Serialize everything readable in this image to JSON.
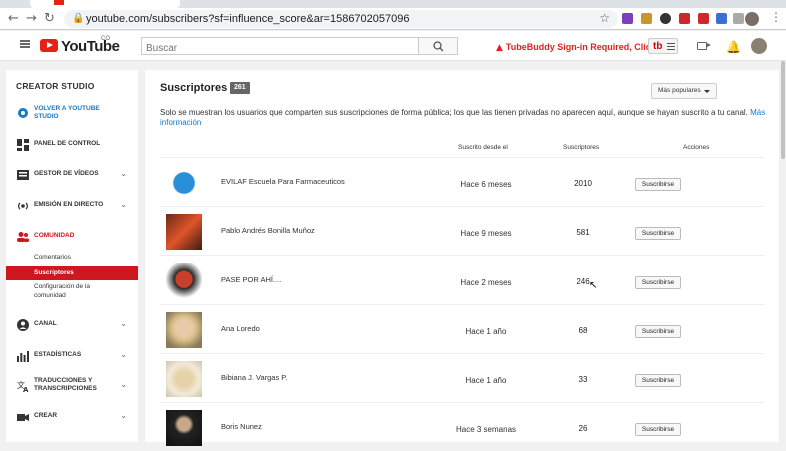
{
  "browser": {
    "url": "youtube.com/subscribers?sf=influence_score&ar=1586702057096"
  },
  "header": {
    "logo_text": "YouTube",
    "region": "CO",
    "search_placeholder": "Buscar",
    "tubebuddy_warning": "TubeBuddy Sign-in Required, Click Here",
    "tubebuddy_badge": "tb"
  },
  "sidebar": {
    "title": "CREATOR STUDIO",
    "items": {
      "back": "VOLVER A YOUTUBE STUDIO",
      "dashboard": "PANEL DE CONTROL",
      "videos": "GESTOR DE VÍDEOS",
      "live": "EMISIÓN EN DIRECTO",
      "community": "COMUNIDAD",
      "channel": "CANAL",
      "analytics": "ESTADÍSTICAS",
      "translations": "TRADUCCIONES Y TRANSCRIPCIONES",
      "create": "CREAR"
    },
    "sub": {
      "comments": "Comentarios",
      "subscribers": "Suscriptores",
      "config": "Configuración de la comunidad"
    },
    "accent_color": "#cc181e"
  },
  "main": {
    "title": "Suscriptores",
    "count": "261",
    "sort_label": "Más populares",
    "note": "Solo se muestran los usuarios que comparten sus suscripciones de forma pública; los que las tienen privadas no aparecen aquí, aunque se hayan suscrito a tu canal.",
    "note_link": "Más información",
    "columns": {
      "since": "Suscrito desde el",
      "subs": "Suscriptores",
      "actions": "Acciones"
    },
    "subscribe_label": "Suscribirse",
    "rows": [
      {
        "name": "EVILAF Escuela Para Farmaceuticos",
        "since": "Hace 6 meses",
        "subs": "2010"
      },
      {
        "name": "Pablo Andrés Bonilla Muñoz",
        "since": "Hace 9 meses",
        "subs": "581"
      },
      {
        "name": "PASE POR AHÍ....",
        "since": "Hace 2 meses",
        "subs": "246"
      },
      {
        "name": "Ana Loredo",
        "since": "Hace 1 año",
        "subs": "68"
      },
      {
        "name": "Bibiana J. Vargas P.",
        "since": "Hace 1 año",
        "subs": "33"
      },
      {
        "name": "Boris Nunez",
        "since": "Hace 3 semanas",
        "subs": "26"
      }
    ]
  }
}
